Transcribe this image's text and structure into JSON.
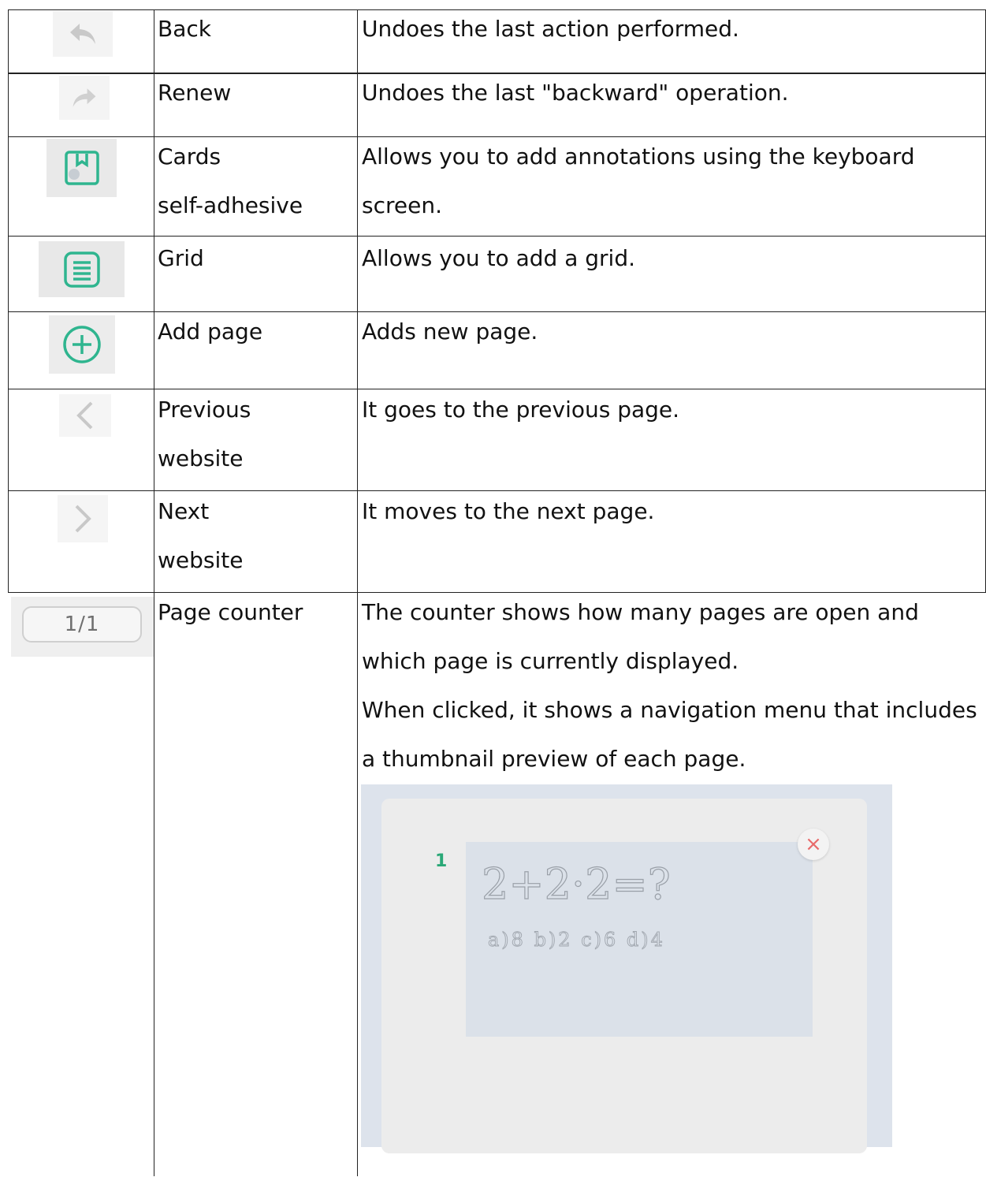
{
  "colors": {
    "accent": "#2fb58f",
    "border": "#222222",
    "icon_gray": "#c8c8c8"
  },
  "rows": [
    {
      "icon": "undo-arrow-icon",
      "name": "Back",
      "description": "Undoes the last action performed."
    },
    {
      "icon": "redo-arrow-icon",
      "name": "Renew",
      "description": "Undoes the last \"backward\" operation."
    },
    {
      "icon": "sticky-note-icon",
      "name": "Cards\nself-adhesive",
      "description": "Allows you to add annotations using the keyboard\nscreen."
    },
    {
      "icon": "grid-list-icon",
      "name": "Grid",
      "description": "Allows you to add a grid."
    },
    {
      "icon": "add-circle-icon",
      "name": "Add page",
      "description": "Adds new page."
    },
    {
      "icon": "chevron-left-icon",
      "name": "Previous\nwebsite",
      "description": "It goes to the previous page."
    },
    {
      "icon": "chevron-right-icon",
      "name": "Next\nwebsite",
      "description": "It moves to the next page."
    },
    {
      "icon": "page-counter-icon",
      "name": "Page counter",
      "description": "The counter shows how many pages are open and\nwhich page is currently displayed.\nWhen clicked, it shows a navigation menu that includes\na thumbnail preview of each page."
    }
  ],
  "page_counter": {
    "value": "1/1"
  },
  "preview": {
    "page_number": "1",
    "close_symbol": "×",
    "handwriting_line1": "2+2·2=?",
    "handwriting_line2": "a)8  b)2  c)6  d)4"
  }
}
